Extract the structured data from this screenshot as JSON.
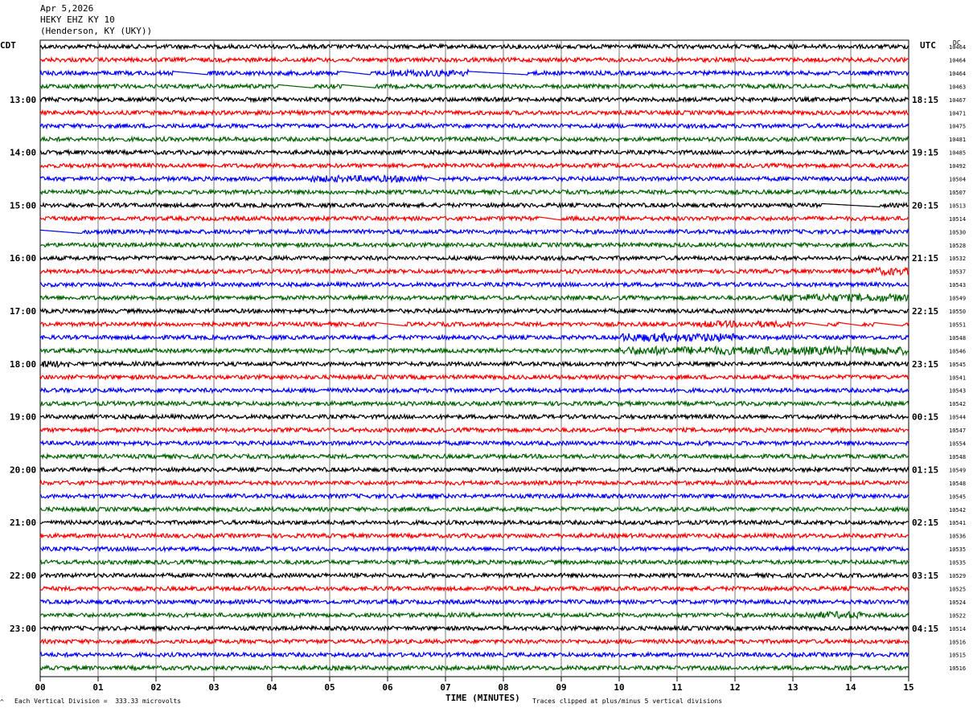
{
  "header": {
    "date": "Apr 5,2026",
    "station": "HEKY EHZ KY 10",
    "location": "(Henderson, KY (UKY))"
  },
  "left_zone": "CDT",
  "right_zone": "UTC",
  "dc_label": "DC",
  "footer": {
    "scale": "Each Vertical Division =  333.33 microvolts",
    "clip": "Traces clipped at plus/minus 5 vertical divisions",
    "corner": "^"
  },
  "chart_data": {
    "type": "line",
    "title": "",
    "xlabel": "TIME (MINUTES)",
    "ylabel": "",
    "xlim": [
      0,
      15
    ],
    "x_ticks": [
      "00",
      "01",
      "02",
      "03",
      "04",
      "05",
      "06",
      "07",
      "08",
      "09",
      "10",
      "11",
      "12",
      "13",
      "14",
      "15"
    ],
    "grid": "vertical every minute",
    "trace_colors": [
      "#000000",
      "#ff0000",
      "#0000ff",
      "#006400"
    ],
    "row_count": 48,
    "left_time_labels": [
      {
        "row": 4,
        "text": "13:00"
      },
      {
        "row": 8,
        "text": "14:00"
      },
      {
        "row": 12,
        "text": "15:00"
      },
      {
        "row": 16,
        "text": "16:00"
      },
      {
        "row": 20,
        "text": "17:00"
      },
      {
        "row": 24,
        "text": "18:00"
      },
      {
        "row": 28,
        "text": "19:00"
      },
      {
        "row": 32,
        "text": "20:00"
      },
      {
        "row": 36,
        "text": "21:00"
      },
      {
        "row": 40,
        "text": "22:00"
      },
      {
        "row": 44,
        "text": "23:00"
      }
    ],
    "right_time_labels": [
      {
        "row": 4,
        "text": "18:15"
      },
      {
        "row": 8,
        "text": "19:15"
      },
      {
        "row": 12,
        "text": "20:15"
      },
      {
        "row": 16,
        "text": "21:15"
      },
      {
        "row": 20,
        "text": "22:15"
      },
      {
        "row": 24,
        "text": "23:15"
      },
      {
        "row": 28,
        "text": "00:15"
      },
      {
        "row": 32,
        "text": "01:15"
      },
      {
        "row": 36,
        "text": "02:15"
      },
      {
        "row": 40,
        "text": "03:15"
      },
      {
        "row": 44,
        "text": "04:15"
      }
    ],
    "dc_offsets": [
      "10464",
      "10464",
      "10464",
      "10463",
      "10467",
      "10471",
      "10475",
      "10481",
      "10485",
      "10492",
      "10504",
      "10507",
      "10513",
      "10514",
      "10530",
      "10528",
      "10532",
      "10537",
      "10543",
      "10549",
      "10550",
      "10551",
      "10548",
      "10546",
      "10545",
      "10541",
      "10543",
      "10542",
      "10544",
      "10547",
      "10554",
      "10548",
      "10549",
      "10548",
      "10545",
      "10542",
      "10541",
      "10536",
      "10535",
      "10535",
      "10529",
      "10525",
      "10524",
      "10522",
      "10514",
      "10516",
      "10515",
      "10516"
    ],
    "gaps": [
      {
        "row": 2,
        "from_min": 2.3,
        "to_min": 2.9
      },
      {
        "row": 2,
        "from_min": 5.2,
        "to_min": 5.7
      },
      {
        "row": 2,
        "from_min": 7.4,
        "to_min": 8.4
      },
      {
        "row": 3,
        "from_min": 4.1,
        "to_min": 4.7
      },
      {
        "row": 3,
        "from_min": 5.2,
        "to_min": 5.8
      },
      {
        "row": 10,
        "from_min": 6.7,
        "to_min": 6.9
      },
      {
        "row": 12,
        "from_min": 13.5,
        "to_min": 14.5
      },
      {
        "row": 13,
        "from_min": 8.6,
        "to_min": 9.0
      },
      {
        "row": 14,
        "from_min": 0.0,
        "to_min": 0.7
      },
      {
        "row": 21,
        "from_min": 5.8,
        "to_min": 6.3
      },
      {
        "row": 21,
        "from_min": 13.2,
        "to_min": 13.6
      },
      {
        "row": 21,
        "from_min": 13.8,
        "to_min": 14.2
      },
      {
        "row": 21,
        "from_min": 14.4,
        "to_min": 14.9
      },
      {
        "row": 24,
        "from_min": 0.5,
        "to_min": 0.6
      }
    ],
    "bursts": [
      {
        "row": 22,
        "from_min": 10.0,
        "to_min": 12.0,
        "amp": 2.0
      },
      {
        "row": 23,
        "from_min": 10.0,
        "to_min": 15.0,
        "amp": 2.0
      },
      {
        "row": 19,
        "from_min": 12.7,
        "to_min": 15.0,
        "amp": 1.8
      },
      {
        "row": 43,
        "from_min": 13.1,
        "to_min": 14.2,
        "amp": 1.7
      },
      {
        "row": 17,
        "from_min": 14.3,
        "to_min": 15.0,
        "amp": 1.8
      },
      {
        "row": 21,
        "from_min": 11.4,
        "to_min": 13.0,
        "amp": 1.6
      },
      {
        "row": 10,
        "from_min": 4.6,
        "to_min": 6.6,
        "amp": 1.6
      },
      {
        "row": 2,
        "from_min": 6.0,
        "to_min": 7.4,
        "amp": 1.6
      },
      {
        "row": 24,
        "from_min": 0.0,
        "to_min": 0.5,
        "amp": 1.6
      }
    ]
  }
}
